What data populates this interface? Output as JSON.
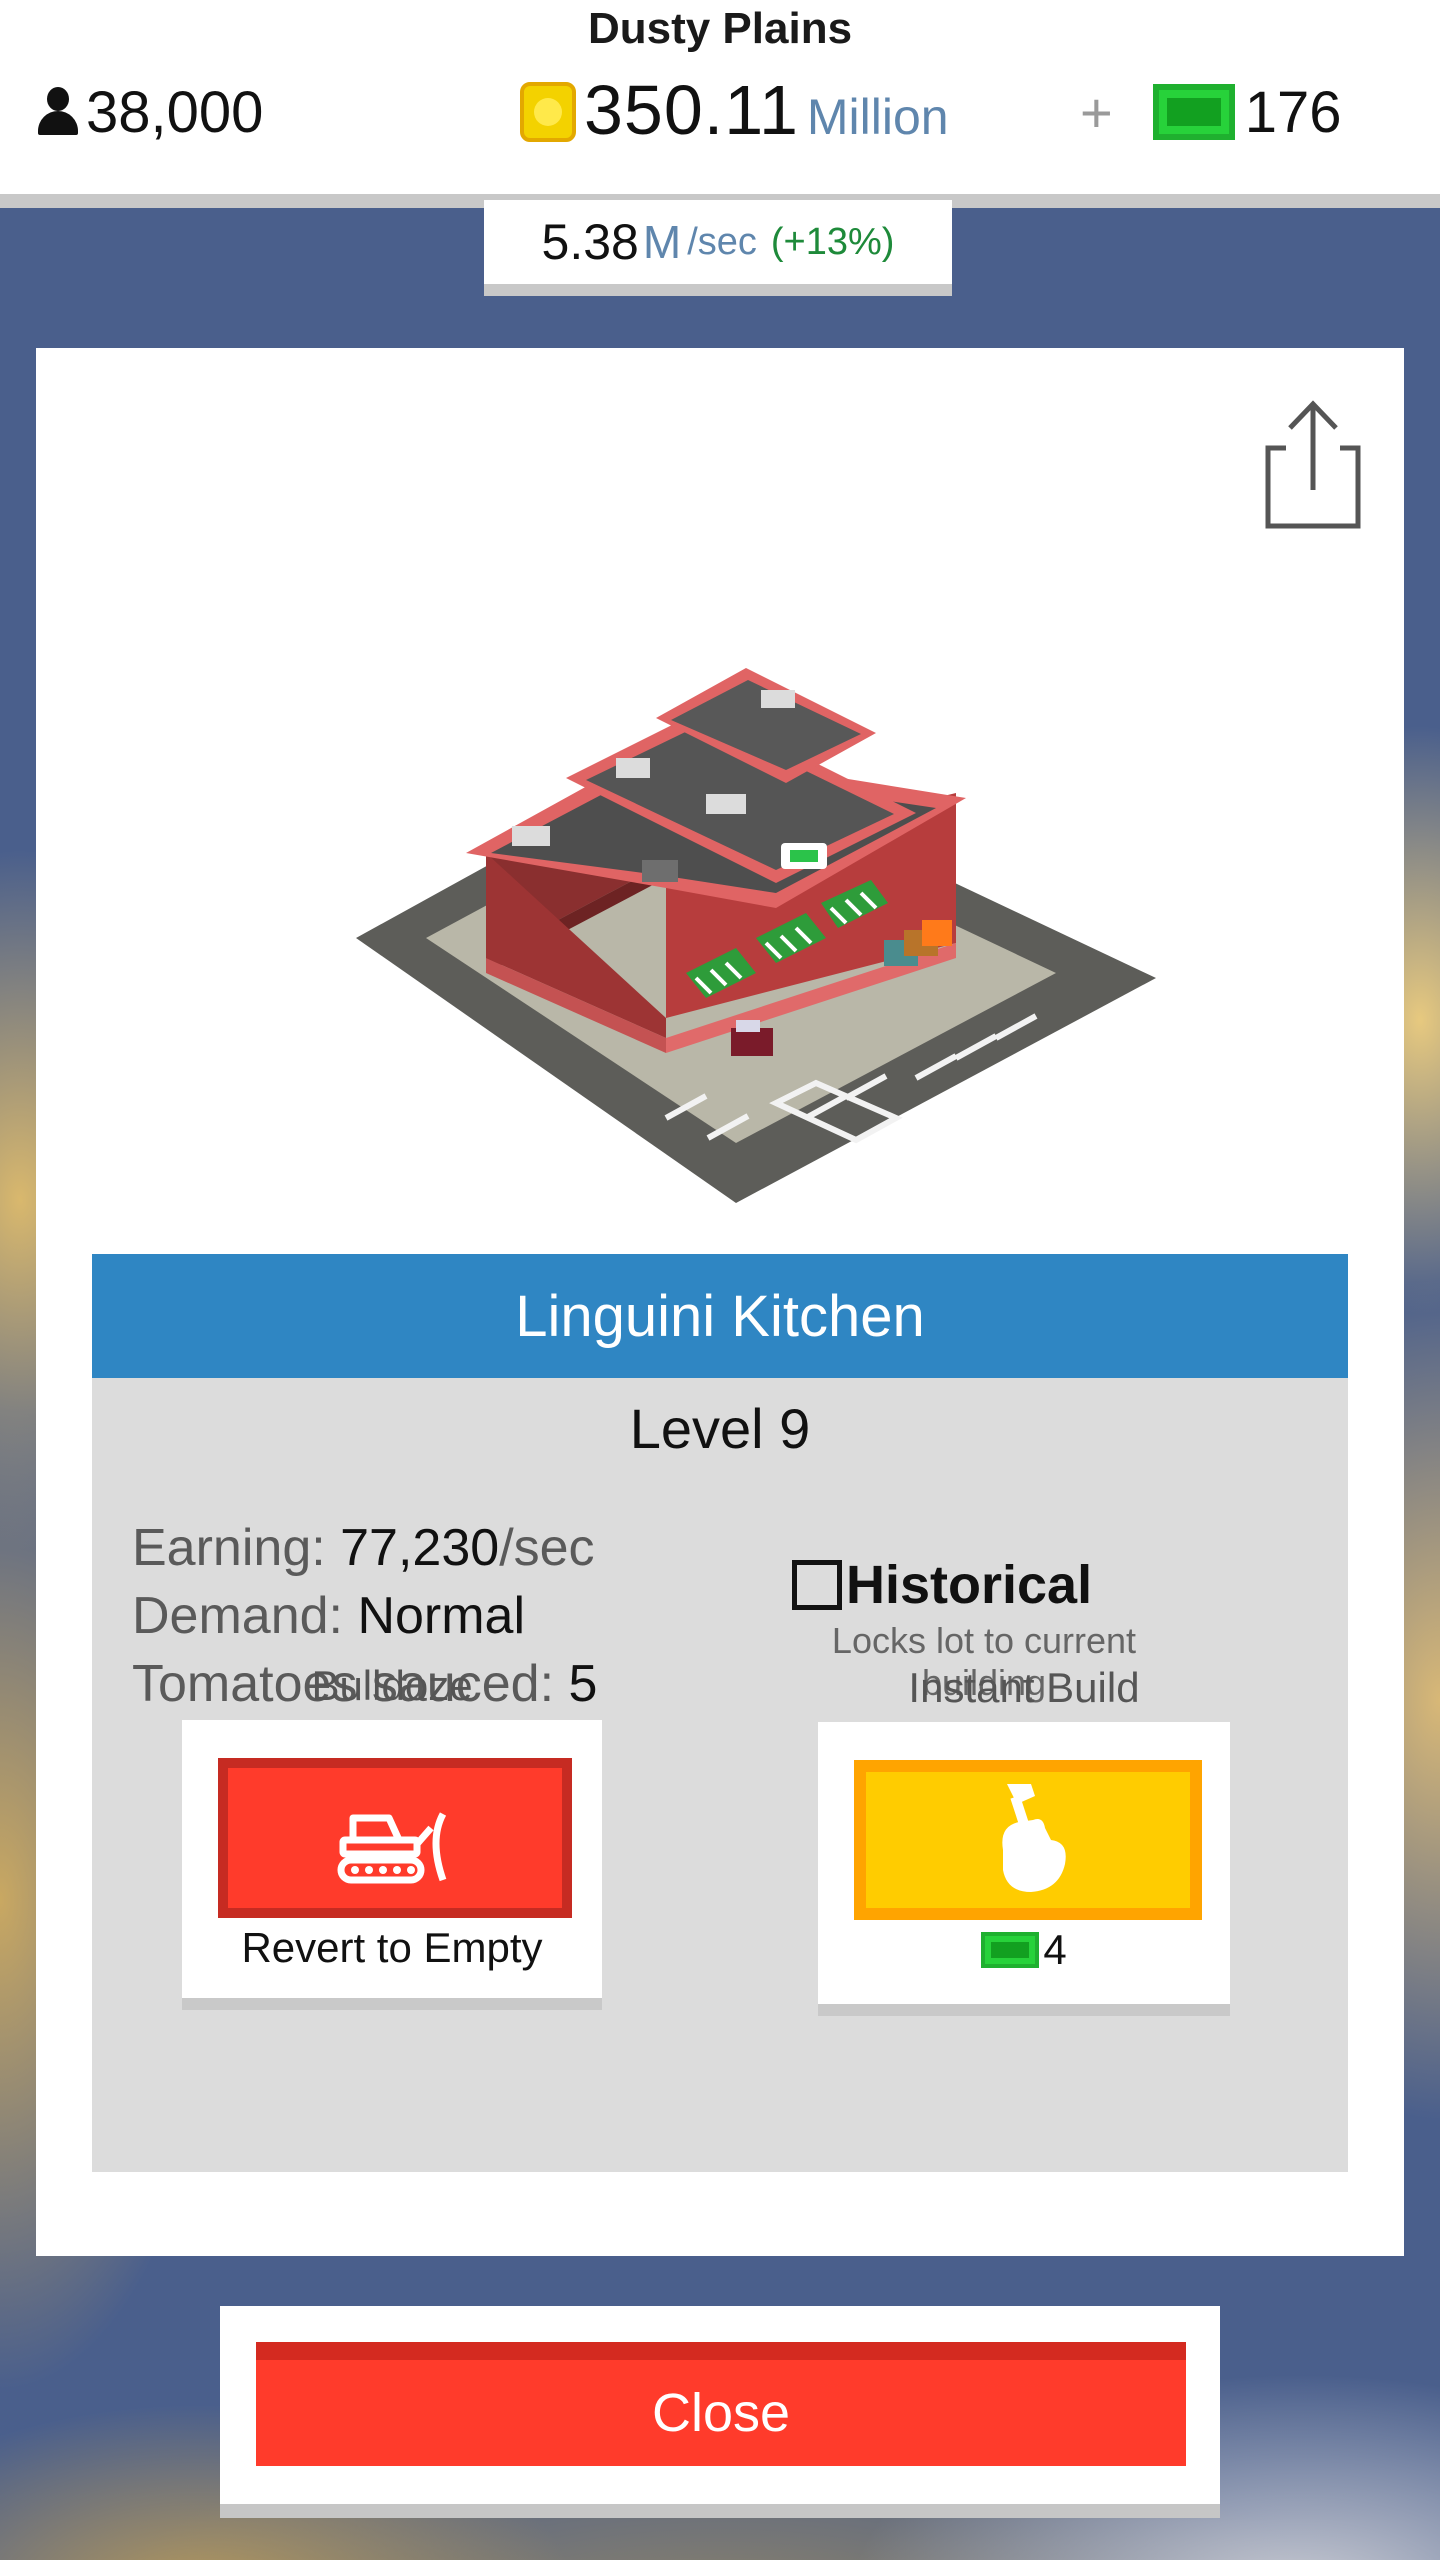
{
  "header": {
    "region_name": "Dusty Plains",
    "population": "38,000",
    "population_icon": "person-icon",
    "cash_value": "350.11",
    "cash_unit": "Million",
    "cash_icon": "coin-icon",
    "bucks_plus": "+",
    "bucks_value": "176",
    "bucks_icon": "city-bucks-icon"
  },
  "income": {
    "value": "5.38",
    "unit": "M",
    "per": "/sec",
    "bonus": "(+13%)"
  },
  "panel": {
    "share_icon": "share-icon",
    "building_image": "linguini-kitchen-building",
    "title": "Linguini Kitchen",
    "level": "Level 9",
    "stats": {
      "earning_label": "Earning: ",
      "earning_value": "77,230",
      "earning_unit": "/sec",
      "demand_label": "Demand: ",
      "demand_value": "Normal",
      "tomatoes_label": "Tomatoes sauced: ",
      "tomatoes_value": "5"
    },
    "historical": {
      "label": "Historical",
      "subtitle": "Locks lot to current building",
      "checked": false
    },
    "bulldoze": {
      "label": "Bulldoze",
      "caption": "Revert to Empty",
      "icon": "bulldozer-icon",
      "color": "#ff3b2b"
    },
    "instant_build": {
      "label": "Instant Build",
      "cost": "4",
      "icon": "hammer-hand-icon",
      "color": "#ffcc00"
    }
  },
  "close_button": {
    "label": "Close",
    "color": "#ff3b2b"
  },
  "colors": {
    "title_bar": "#2f86c3",
    "background": "#4a5f8c",
    "money_unit": "#5f86ad",
    "bonus": "#1e8a3a"
  }
}
